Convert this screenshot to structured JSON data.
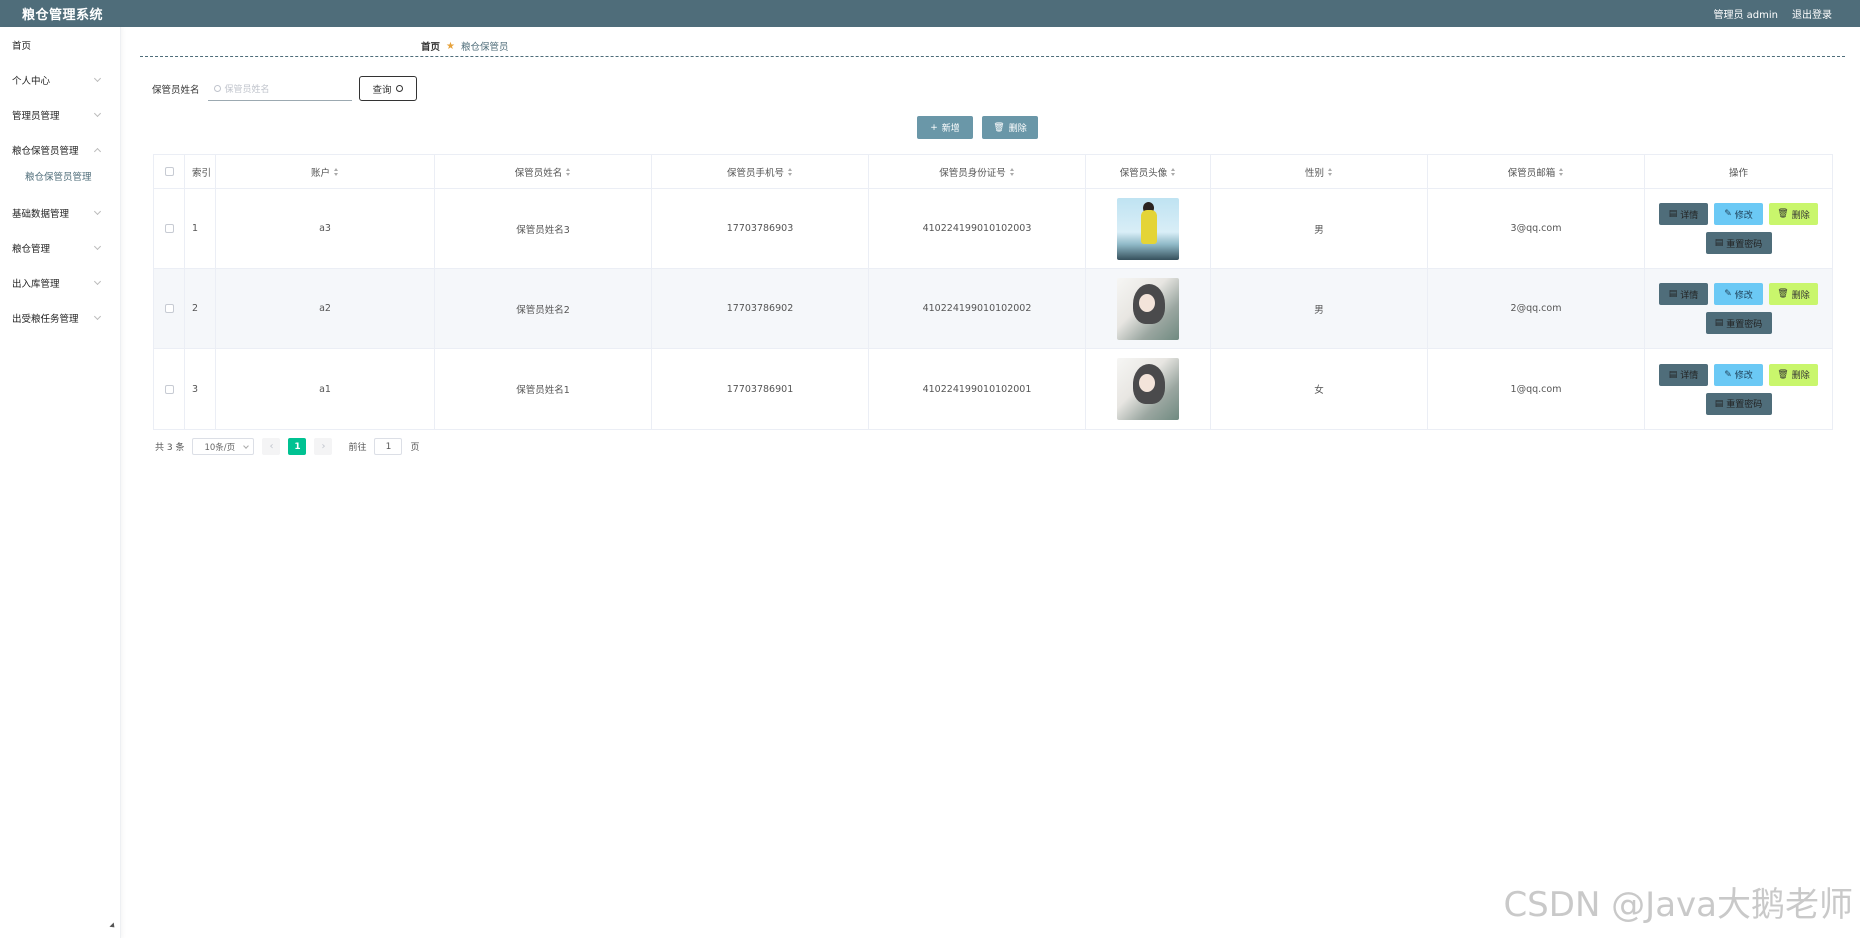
{
  "header": {
    "app_title": "粮仓管理系统",
    "user_label": "管理员 admin",
    "logout_label": "退出登录"
  },
  "sidebar": {
    "items": [
      {
        "label": "首页"
      },
      {
        "label": "个人中心"
      },
      {
        "label": "管理员管理"
      },
      {
        "label": "粮仓保管员管理"
      },
      {
        "label": "基础数据管理"
      },
      {
        "label": "粮仓管理"
      },
      {
        "label": "出入库管理"
      },
      {
        "label": "出受粮任务管理"
      }
    ],
    "sub_item": "粮仓保管员管理"
  },
  "breadcrumb": {
    "home": "首页",
    "current": "粮仓保管员"
  },
  "search": {
    "label": "保管员姓名",
    "placeholder": "保管员姓名",
    "button": "查询"
  },
  "toolbar": {
    "add_label": "新增",
    "delete_label": "删除"
  },
  "table": {
    "headers": {
      "index": "索引",
      "account": "账户",
      "name": "保管员姓名",
      "phone": "保管员手机号",
      "idcard": "保管员身份证号",
      "avatar": "保管员头像",
      "gender": "性别",
      "email": "保管员邮箱",
      "ops": "操作"
    },
    "rows": [
      {
        "index": "1",
        "account": "a3",
        "name": "保管员姓名3",
        "phone": "17703786903",
        "idcard": "410224199010102003",
        "gender": "男",
        "email": "3@qq.com"
      },
      {
        "index": "2",
        "account": "a2",
        "name": "保管员姓名2",
        "phone": "17703786902",
        "idcard": "410224199010102002",
        "gender": "男",
        "email": "2@qq.com"
      },
      {
        "index": "3",
        "account": "a1",
        "name": "保管员姓名1",
        "phone": "17703786901",
        "idcard": "410224199010102001",
        "gender": "女",
        "email": "1@qq.com"
      }
    ],
    "ops": {
      "detail": "详情",
      "edit": "修改",
      "delete": "删除",
      "reset": "重置密码"
    }
  },
  "pagination": {
    "total": "共 3 条",
    "page_size": "10条/页",
    "current_page": "1",
    "goto_label": "前往",
    "goto_value": "1",
    "page_unit": "页"
  },
  "watermark": "CSDN @Java大鹅老师",
  "colors": {
    "header_bg": "#4f6d7a",
    "accent_green": "#00c292",
    "edit_blue": "#6bc9f5",
    "delete_lime": "#c9f66c"
  }
}
